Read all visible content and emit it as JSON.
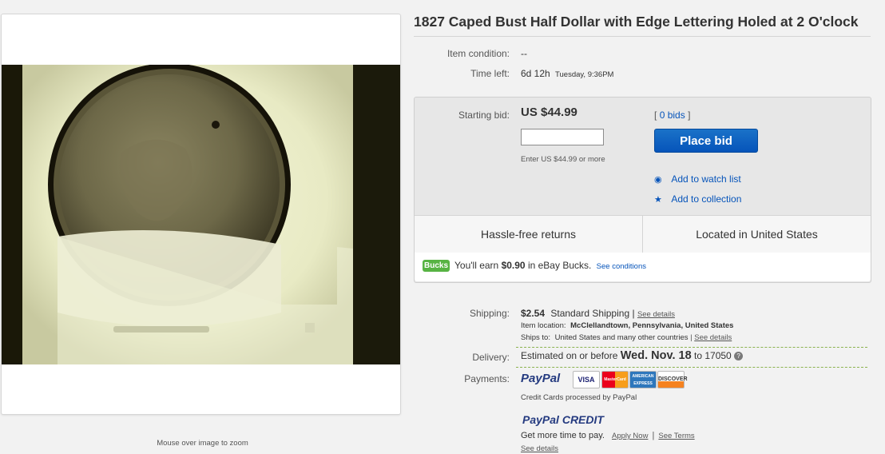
{
  "title": "1827 Caped Bust Half Dollar with Edge Lettering Holed at 2 O'clock",
  "image": {
    "zoom_hint": "Mouse over image to zoom"
  },
  "condition": {
    "label": "Item condition:",
    "value": "--"
  },
  "time_left": {
    "label": "Time left:",
    "value": "6d 12h",
    "detail": "Tuesday, 9:36PM"
  },
  "bid": {
    "label": "Starting bid:",
    "price": "US $44.99",
    "input_value": "",
    "hint": "Enter US $44.99 or more",
    "bids_open": "[",
    "bids_link": "0 bids",
    "bids_close": "]",
    "place_bid": "Place bid",
    "watch": "Add to watch list",
    "collection": "Add to collection"
  },
  "features": {
    "returns": "Hassle-free returns",
    "location": "Located in United States"
  },
  "bucks": {
    "badge": "Bucks",
    "text_before": "You'll earn",
    "amount": "$0.90",
    "text_after": "in eBay Bucks.",
    "link": "See conditions"
  },
  "shipping": {
    "label": "Shipping:",
    "price": "$2.54",
    "method": "Standard Shipping",
    "sep": "|",
    "details": "See details",
    "location_label": "Item location:",
    "location": "McClellandtown, Pennsylvania, United States",
    "ships_label": "Ships to:",
    "ships_to": "United States and many other countries",
    "ships_details": "See details"
  },
  "delivery": {
    "label": "Delivery:",
    "text": "Estimated on or before",
    "date": "Wed. Nov. 18",
    "to": "to",
    "zip": "17050",
    "help": "?"
  },
  "payments": {
    "label": "Payments:",
    "paypal": "PayPal",
    "cards": [
      "VISA",
      "MasterCard",
      "AMERICAN EXPRESS",
      "DISCOVER"
    ],
    "card_note": "Credit Cards processed by PayPal",
    "credit_logo_a": "PayPal",
    "credit_logo_b": "CREDIT",
    "credit_text": "Get more time to pay.",
    "apply": "Apply Now",
    "sep": "|",
    "terms": "See Terms",
    "details": "See details"
  },
  "colors": {
    "accent": "#0654ba",
    "bucks": "#57b343",
    "paypal_dark": "#253b80",
    "paypal_light": "#179bd7"
  }
}
